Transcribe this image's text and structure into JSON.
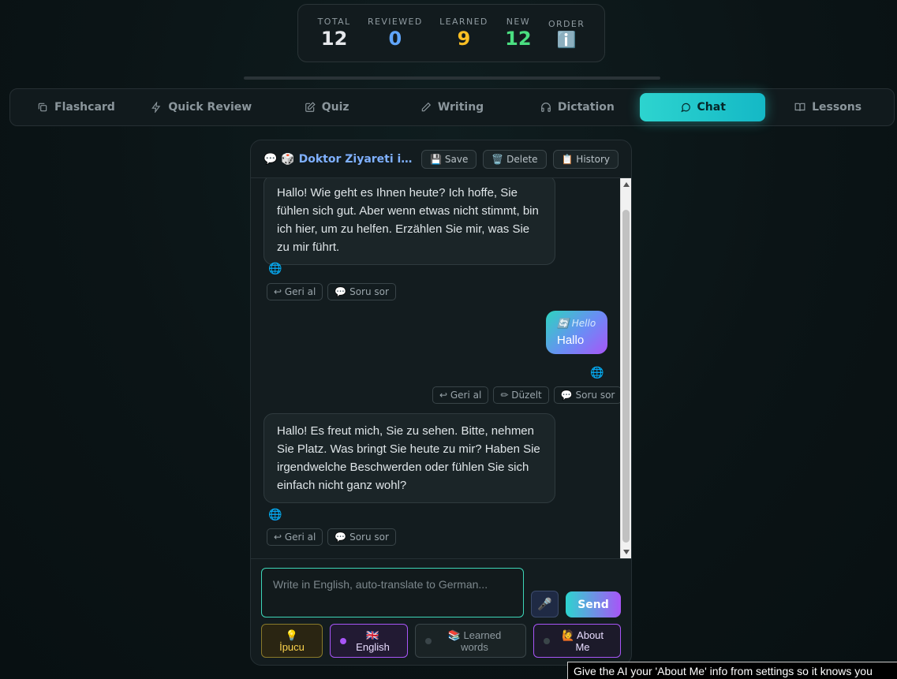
{
  "stats": [
    {
      "label": "TOTAL",
      "value": "12",
      "color": "#e5e7eb"
    },
    {
      "label": "REVIEWED",
      "value": "0",
      "color": "#60a5fa"
    },
    {
      "label": "LEARNED",
      "value": "9",
      "color": "#fbbf24"
    },
    {
      "label": "NEW",
      "value": "12",
      "color": "#4ade80"
    },
    {
      "label": "ORDER",
      "value": "ℹ️",
      "color": "#60a5fa"
    }
  ],
  "progress": {
    "fraction": 0
  },
  "tabs": [
    {
      "label": "Flashcard",
      "icon": "copy-icon"
    },
    {
      "label": "Quick Review",
      "icon": "lightning-icon"
    },
    {
      "label": "Quiz",
      "icon": "edit-icon"
    },
    {
      "label": "Writing",
      "icon": "pencil-icon"
    },
    {
      "label": "Dictation",
      "icon": "headphones-icon"
    },
    {
      "label": "Chat",
      "icon": "chat-bubble-icon",
      "active": true
    },
    {
      "label": "Lessons",
      "icon": "book-icon"
    }
  ],
  "chat": {
    "title": "💬 🎲 Doktor Ziyareti ile doktor",
    "save_label": "💾 Save",
    "delete_label": "🗑️ Delete",
    "history_label": "📋 History",
    "messages": {
      "ai1": "Hallo! Wie geht es Ihnen heute? Ich hoffe, Sie fühlen sich gut. Aber wenn etwas nicht stimmt, bin ich hier, um zu helfen. Erzählen Sie mir, was Sie zu mir führt.",
      "user1_translation": "🔄 Hello",
      "user1": "Hallo",
      "ai2": "Hallo! Es freut mich, Sie zu sehen. Bitte, nehmen Sie Platz. Was bringt Sie heute zu mir? Haben Sie irgendwelche Beschwerden oder fühlen Sie sich einfach nicht ganz wohl?"
    },
    "globe_icon": "🌐",
    "undo_label": "↩ Geri al",
    "edit_label": "✏ Düzelt",
    "ask_label": "💬 Soru sor",
    "input_placeholder": "Write in English, auto-translate to German...",
    "mic_icon": "🎤",
    "send_label": "Send",
    "hint_label": "💡 İpucu",
    "english_label": "🇬🇧 English",
    "learned_label": "📚 Learned words",
    "about_label": "🙋 About Me"
  },
  "tooltip": "Give the AI your 'About Me' info from settings so it knows you"
}
